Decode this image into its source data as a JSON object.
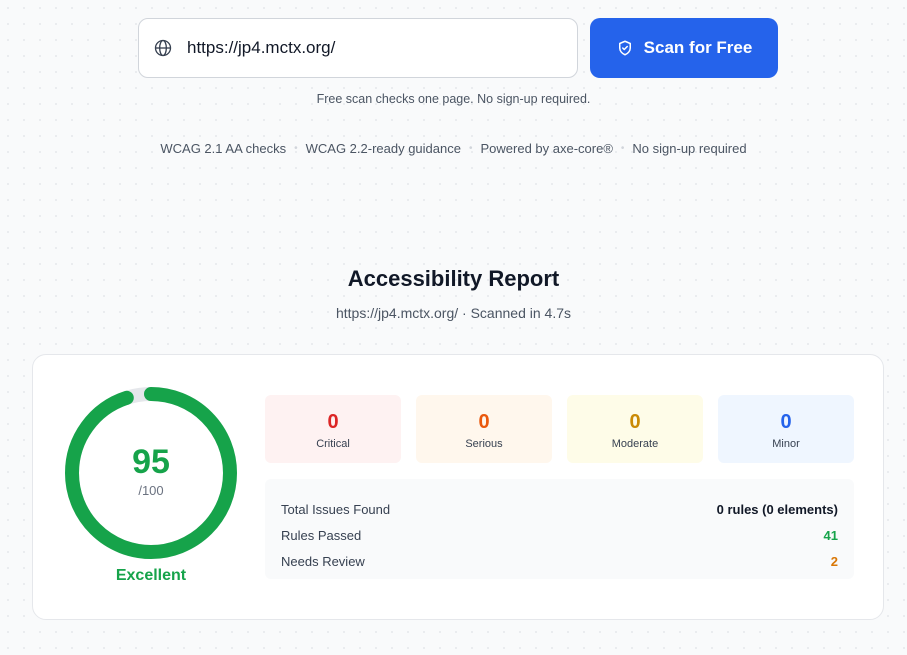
{
  "scan": {
    "url_value": "https://jp4.mctx.org/",
    "button_label": "Scan for Free",
    "note": "Free scan checks one page. No sign-up required."
  },
  "features": [
    "WCAG 2.1 AA checks",
    "WCAG 2.2-ready guidance",
    "Powered by axe-core®",
    "No sign-up required"
  ],
  "report": {
    "title": "Accessibility Report",
    "subtitle": "https://jp4.mctx.org/ · Scanned in 4.7s",
    "score": "95",
    "score_max": "/100",
    "score_value": 95,
    "rating": "Excellent",
    "severity": {
      "critical": {
        "count": "0",
        "label": "Critical"
      },
      "serious": {
        "count": "0",
        "label": "Serious"
      },
      "moderate": {
        "count": "0",
        "label": "Moderate"
      },
      "minor": {
        "count": "0",
        "label": "Minor"
      }
    },
    "summary": {
      "total_label": "Total Issues Found",
      "total_value": "0 rules (0 elements)",
      "passed_label": "Rules Passed",
      "passed_value": "41",
      "review_label": "Needs Review",
      "review_value": "2"
    }
  },
  "colors": {
    "accent": "#2563eb",
    "good": "#16a34a",
    "critical": "#dc2626",
    "serious": "#ea580c",
    "moderate": "#ca8a04",
    "minor": "#2563eb"
  },
  "icons": {
    "url": "globe-icon",
    "button": "shield-check-icon"
  }
}
